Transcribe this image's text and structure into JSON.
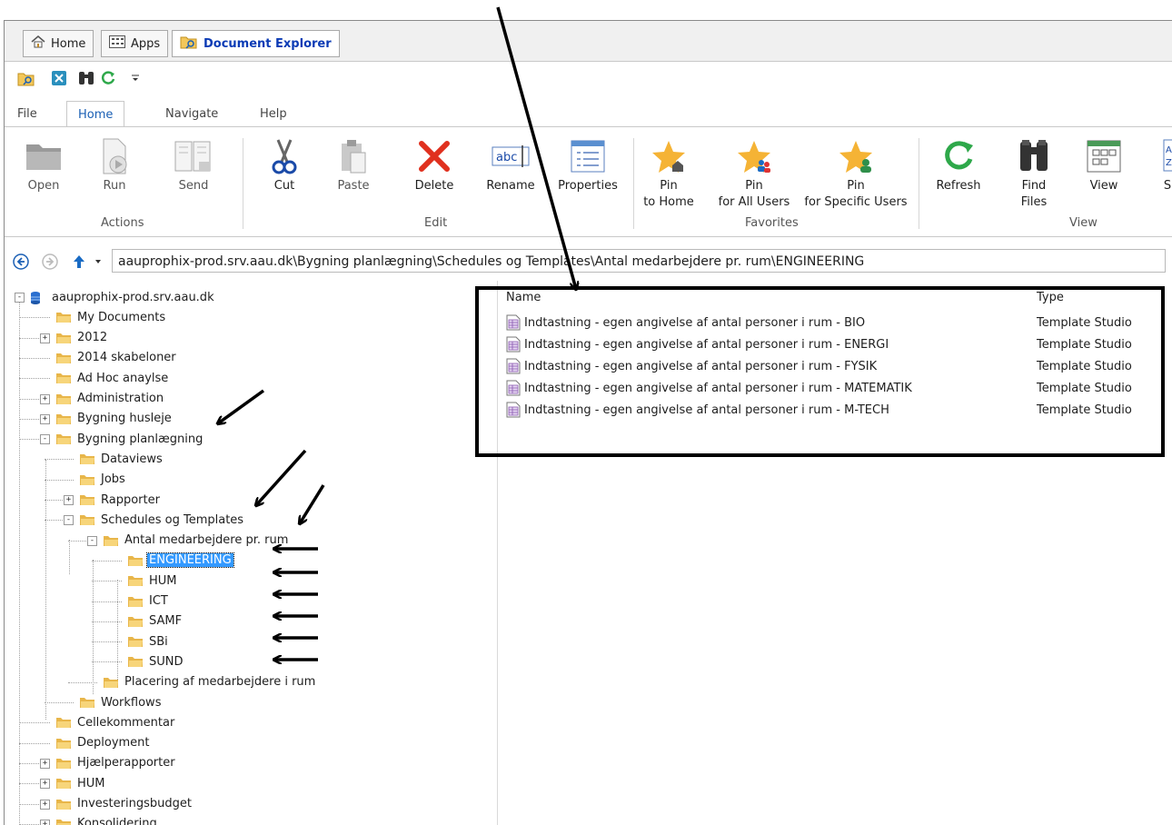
{
  "app_tabs": [
    {
      "label": "Home",
      "icon": "home-icon"
    },
    {
      "label": "Apps",
      "icon": "apps-grid-icon"
    },
    {
      "label": "Document Explorer",
      "icon": "document-explorer-icon"
    }
  ],
  "ribbon_tabs": [
    "File",
    "Home",
    "Navigate",
    "Help"
  ],
  "ribbon_active_tab": "Home",
  "ribbon": {
    "actions": {
      "label": "Actions",
      "open": "Open",
      "run": "Run",
      "send": "Send"
    },
    "edit": {
      "label": "Edit",
      "cut": "Cut",
      "paste": "Paste",
      "delete": "Delete",
      "rename": "Rename",
      "properties": "Properties"
    },
    "favorites": {
      "label": "Favorites",
      "pin_home_1": "Pin",
      "pin_home_2": "to Home",
      "pin_all_1": "Pin",
      "pin_all_2": "for All Users",
      "pin_specific_1": "Pin",
      "pin_specific_2": "for Specific Users"
    },
    "view": {
      "label": "View",
      "refresh": "Refresh",
      "find_1": "Find",
      "find_2": "Files",
      "view": "View",
      "cut_off": "S"
    }
  },
  "address": {
    "path": "aauprophix-prod.srv.aau.dk\\Bygning planlægning\\Schedules og Templates\\Antal medarbejdere pr. rum\\ENGINEERING"
  },
  "tree": {
    "root": "aauprophix-prod.srv.aau.dk",
    "items": [
      "My Documents",
      "2012",
      "2014 skabeloner",
      "Ad Hoc anaylse",
      "Administration",
      "Bygning husleje",
      "Bygning planlægning",
      "Dataviews",
      "Jobs",
      "Rapporter",
      "Schedules og Templates",
      "Antal medarbejdere pr. rum",
      "ENGINEERING",
      "HUM",
      "ICT",
      "SAMF",
      "SBi",
      "SUND",
      "Placering af medarbejdere i rum",
      "Workflows",
      "Cellekommentar",
      "Deployment",
      "Hjælperapporter",
      "HUM",
      "Investeringsbudget",
      "Konsolidering"
    ],
    "selected": "ENGINEERING"
  },
  "list": {
    "headers": {
      "name": "Name",
      "type": "Type"
    },
    "rows": [
      {
        "name": "Indtastning - egen angivelse af antal personer i rum - BIO",
        "type": "Template Studio"
      },
      {
        "name": "Indtastning - egen angivelse af antal personer i rum - ENERGI",
        "type": "Template Studio"
      },
      {
        "name": "Indtastning - egen angivelse af antal personer i rum - FYSIK",
        "type": "Template Studio"
      },
      {
        "name": "Indtastning - egen angivelse af antal personer i rum - MATEMATIK",
        "type": "Template Studio"
      },
      {
        "name": "Indtastning - egen angivelse af antal personer i rum - M-TECH",
        "type": "Template Studio"
      }
    ]
  },
  "colors": {
    "accent": "#1a5fb4",
    "selection": "#3399ff",
    "folder": "#f3c75a",
    "delete": "#e0301e",
    "refresh": "#2ea84a",
    "star": "#f5b335"
  }
}
